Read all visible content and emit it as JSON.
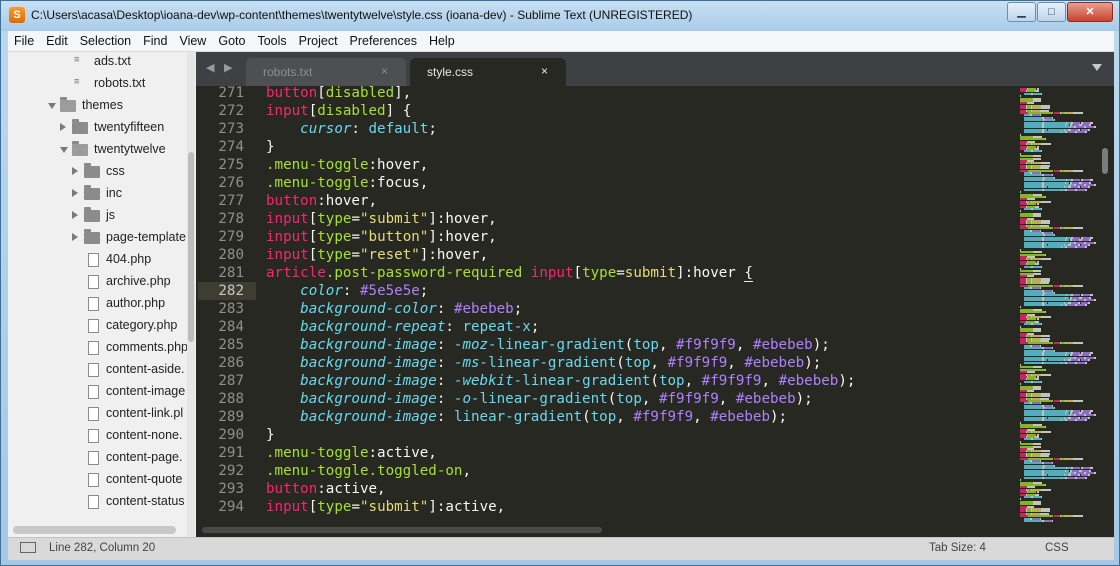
{
  "window": {
    "title": "C:\\Users\\acasa\\Desktop\\ioana-dev\\wp-content\\themes\\twentytwelve\\style.css (ioana-dev) - Sublime Text (UNREGISTERED)",
    "minimize_label": "▁",
    "maximize_label": "□",
    "close_label": "✕",
    "app_icon_glyph": "S"
  },
  "menu": [
    "File",
    "Edit",
    "Selection",
    "Find",
    "View",
    "Goto",
    "Tools",
    "Project",
    "Preferences",
    "Help"
  ],
  "sidebar": {
    "items": [
      {
        "label": "ads.txt",
        "kind": "txt",
        "depth": 2
      },
      {
        "label": "robots.txt",
        "kind": "txt",
        "depth": 2
      },
      {
        "label": "themes",
        "kind": "folder",
        "open": true,
        "depth": 1
      },
      {
        "label": "twentyfifteen",
        "kind": "folder",
        "open": false,
        "depth": 2
      },
      {
        "label": "twentytwelve",
        "kind": "folder",
        "open": true,
        "depth": 2
      },
      {
        "label": "css",
        "kind": "folder",
        "open": false,
        "depth": 3
      },
      {
        "label": "inc",
        "kind": "folder",
        "open": false,
        "depth": 3
      },
      {
        "label": "js",
        "kind": "folder",
        "open": false,
        "depth": 3
      },
      {
        "label": "page-template",
        "kind": "folder",
        "open": false,
        "depth": 3
      },
      {
        "label": "404.php",
        "kind": "file",
        "depth": 3
      },
      {
        "label": "archive.php",
        "kind": "file",
        "depth": 3
      },
      {
        "label": "author.php",
        "kind": "file",
        "depth": 3
      },
      {
        "label": "category.php",
        "kind": "file",
        "depth": 3
      },
      {
        "label": "comments.php",
        "kind": "file",
        "depth": 3
      },
      {
        "label": "content-aside.",
        "kind": "file",
        "depth": 3
      },
      {
        "label": "content-image",
        "kind": "file",
        "depth": 3
      },
      {
        "label": "content-link.pl",
        "kind": "file",
        "depth": 3
      },
      {
        "label": "content-none.",
        "kind": "file",
        "depth": 3
      },
      {
        "label": "content-page.",
        "kind": "file",
        "depth": 3
      },
      {
        "label": "content-quote",
        "kind": "file",
        "depth": 3
      },
      {
        "label": "content-status",
        "kind": "file",
        "depth": 3
      }
    ]
  },
  "tabs": {
    "nav_label": "◀ ▶",
    "items": [
      {
        "label": "robots.txt",
        "active": false,
        "close": "×"
      },
      {
        "label": "style.css",
        "active": true,
        "close": "×"
      }
    ]
  },
  "editor": {
    "current_line": 282,
    "lines": [
      {
        "n": "271",
        "tokens": [
          [
            "t-tag",
            "button"
          ],
          [
            "t-p",
            "["
          ],
          [
            "t-attr",
            "disabled"
          ],
          [
            "t-p",
            "],"
          ]
        ]
      },
      {
        "n": "272",
        "tokens": [
          [
            "t-tag",
            "input"
          ],
          [
            "t-p",
            "["
          ],
          [
            "t-attr",
            "disabled"
          ],
          [
            "t-p",
            "] {"
          ]
        ]
      },
      {
        "n": "273",
        "tokens": [
          [
            "t-p",
            "    "
          ],
          [
            "t-prop",
            "cursor"
          ],
          [
            "t-p",
            ": "
          ],
          [
            "t-kw",
            "default"
          ],
          [
            "t-p",
            ";"
          ]
        ]
      },
      {
        "n": "274",
        "tokens": [
          [
            "t-p",
            "}"
          ]
        ]
      },
      {
        "n": "275",
        "tokens": [
          [
            "t-cls",
            ".menu-toggle"
          ],
          [
            "t-p",
            ":hover,"
          ]
        ]
      },
      {
        "n": "276",
        "tokens": [
          [
            "t-cls",
            ".menu-toggle"
          ],
          [
            "t-p",
            ":focus,"
          ]
        ]
      },
      {
        "n": "277",
        "tokens": [
          [
            "t-tag",
            "button"
          ],
          [
            "t-p",
            ":hover,"
          ]
        ]
      },
      {
        "n": "278",
        "tokens": [
          [
            "t-tag",
            "input"
          ],
          [
            "t-p",
            "["
          ],
          [
            "t-attr",
            "type"
          ],
          [
            "t-p",
            "="
          ],
          [
            "t-str",
            "\"submit\""
          ],
          [
            "t-p",
            "]:hover,"
          ]
        ]
      },
      {
        "n": "279",
        "tokens": [
          [
            "t-tag",
            "input"
          ],
          [
            "t-p",
            "["
          ],
          [
            "t-attr",
            "type"
          ],
          [
            "t-p",
            "="
          ],
          [
            "t-str",
            "\"button\""
          ],
          [
            "t-p",
            "]:hover,"
          ]
        ]
      },
      {
        "n": "280",
        "tokens": [
          [
            "t-tag",
            "input"
          ],
          [
            "t-p",
            "["
          ],
          [
            "t-attr",
            "type"
          ],
          [
            "t-p",
            "="
          ],
          [
            "t-str",
            "\"reset\""
          ],
          [
            "t-p",
            "]:hover,"
          ]
        ]
      },
      {
        "n": "281",
        "tokens": [
          [
            "t-tag",
            "article"
          ],
          [
            "t-cls",
            ".post-password-required"
          ],
          [
            "t-p",
            " "
          ],
          [
            "t-tag",
            "input"
          ],
          [
            "t-p",
            "["
          ],
          [
            "t-attr",
            "type"
          ],
          [
            "t-p",
            "="
          ],
          [
            "t-str",
            "submit"
          ],
          [
            "t-p",
            "]:hover "
          ],
          [
            "t-p cursor-mark",
            "{"
          ]
        ]
      },
      {
        "n": "282",
        "tokens": [
          [
            "t-p",
            "    "
          ],
          [
            "t-prop",
            "color"
          ],
          [
            "t-p",
            ": "
          ],
          [
            "t-num",
            "#5e5e5e"
          ],
          [
            "t-p",
            ";"
          ]
        ]
      },
      {
        "n": "283",
        "tokens": [
          [
            "t-p",
            "    "
          ],
          [
            "t-prop",
            "background-color"
          ],
          [
            "t-p",
            ": "
          ],
          [
            "t-num",
            "#ebebeb"
          ],
          [
            "t-p",
            ";"
          ]
        ]
      },
      {
        "n": "284",
        "tokens": [
          [
            "t-p",
            "    "
          ],
          [
            "t-prop",
            "background-repeat"
          ],
          [
            "t-p",
            ": "
          ],
          [
            "t-kw",
            "repeat-x"
          ],
          [
            "t-p",
            ";"
          ]
        ]
      },
      {
        "n": "285",
        "tokens": [
          [
            "t-p",
            "    "
          ],
          [
            "t-prop",
            "background-image"
          ],
          [
            "t-p",
            ": "
          ],
          [
            "t-fn",
            "-moz-"
          ],
          [
            "t-kw",
            "linear-gradient"
          ],
          [
            "t-p",
            "("
          ],
          [
            "t-kw",
            "top"
          ],
          [
            "t-p",
            ", "
          ],
          [
            "t-num",
            "#f9f9f9"
          ],
          [
            "t-p",
            ", "
          ],
          [
            "t-num",
            "#ebebeb"
          ],
          [
            "t-p",
            ");"
          ]
        ]
      },
      {
        "n": "286",
        "tokens": [
          [
            "t-p",
            "    "
          ],
          [
            "t-prop",
            "background-image"
          ],
          [
            "t-p",
            ": "
          ],
          [
            "t-fn",
            "-ms-"
          ],
          [
            "t-kw",
            "linear-gradient"
          ],
          [
            "t-p",
            "("
          ],
          [
            "t-kw",
            "top"
          ],
          [
            "t-p",
            ", "
          ],
          [
            "t-num",
            "#f9f9f9"
          ],
          [
            "t-p",
            ", "
          ],
          [
            "t-num",
            "#ebebeb"
          ],
          [
            "t-p",
            ");"
          ]
        ]
      },
      {
        "n": "287",
        "tokens": [
          [
            "t-p",
            "    "
          ],
          [
            "t-prop",
            "background-image"
          ],
          [
            "t-p",
            ": "
          ],
          [
            "t-fn",
            "-webkit-"
          ],
          [
            "t-kw",
            "linear-gradient"
          ],
          [
            "t-p",
            "("
          ],
          [
            "t-kw",
            "top"
          ],
          [
            "t-p",
            ", "
          ],
          [
            "t-num",
            "#f9f9f9"
          ],
          [
            "t-p",
            ", "
          ],
          [
            "t-num",
            "#ebebeb"
          ],
          [
            "t-p",
            ");"
          ]
        ]
      },
      {
        "n": "288",
        "tokens": [
          [
            "t-p",
            "    "
          ],
          [
            "t-prop",
            "background-image"
          ],
          [
            "t-p",
            ": "
          ],
          [
            "t-fn",
            "-o-"
          ],
          [
            "t-kw",
            "linear-gradient"
          ],
          [
            "t-p",
            "("
          ],
          [
            "t-kw",
            "top"
          ],
          [
            "t-p",
            ", "
          ],
          [
            "t-num",
            "#f9f9f9"
          ],
          [
            "t-p",
            ", "
          ],
          [
            "t-num",
            "#ebebeb"
          ],
          [
            "t-p",
            ");"
          ]
        ]
      },
      {
        "n": "289",
        "tokens": [
          [
            "t-p",
            "    "
          ],
          [
            "t-prop",
            "background-image"
          ],
          [
            "t-p",
            ": "
          ],
          [
            "t-kw",
            "linear-gradient"
          ],
          [
            "t-p",
            "("
          ],
          [
            "t-kw",
            "top"
          ],
          [
            "t-p",
            ", "
          ],
          [
            "t-num",
            "#f9f9f9"
          ],
          [
            "t-p",
            ", "
          ],
          [
            "t-num",
            "#ebebeb"
          ],
          [
            "t-p",
            ");"
          ]
        ]
      },
      {
        "n": "290",
        "tokens": [
          [
            "t-p",
            "}"
          ]
        ]
      },
      {
        "n": "291",
        "tokens": [
          [
            "t-cls",
            ".menu-toggle"
          ],
          [
            "t-p",
            ":active,"
          ]
        ]
      },
      {
        "n": "292",
        "tokens": [
          [
            "t-cls",
            ".menu-toggle.toggled-on"
          ],
          [
            "t-p",
            ","
          ]
        ]
      },
      {
        "n": "293",
        "tokens": [
          [
            "t-tag",
            "button"
          ],
          [
            "t-p",
            ":active,"
          ]
        ]
      },
      {
        "n": "294",
        "tokens": [
          [
            "t-tag",
            "input"
          ],
          [
            "t-p",
            "["
          ],
          [
            "t-attr",
            "type"
          ],
          [
            "t-p",
            "="
          ],
          [
            "t-str",
            "\"submit\""
          ],
          [
            "t-p",
            "]:active,"
          ]
        ]
      }
    ]
  },
  "status": {
    "position": "Line 282, Column 20",
    "tab_size": "Tab Size: 4",
    "syntax": "CSS"
  },
  "colors": {
    "editor_bg": "#272822",
    "tag": "#f92672",
    "class": "#a6e22e",
    "string": "#e6db74",
    "property": "#66d9ef",
    "number": "#ae81ff",
    "plain": "#f8f8f2"
  }
}
